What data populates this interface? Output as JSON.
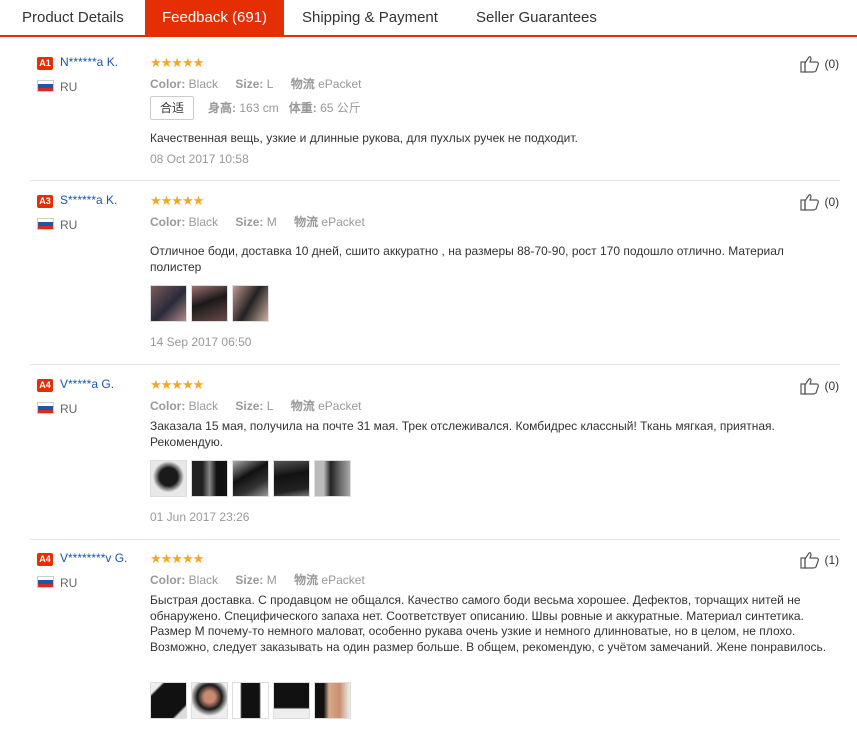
{
  "tabs": [
    {
      "label": "Product Details",
      "active": false
    },
    {
      "label": "Feedback (691)",
      "active": true
    },
    {
      "label": "Shipping & Payment",
      "active": false
    },
    {
      "label": "Seller Guarantees",
      "active": false
    }
  ],
  "attr_keys": {
    "color": "Color:",
    "size": "Size:",
    "ship": "物流",
    "fit": "合适",
    "height": "身高:",
    "weight": "体重:"
  },
  "country_flag_colors": [
    "#ffffff",
    "#1c57a7",
    "#d52b1e"
  ],
  "star_rating": 5,
  "reviews": [
    {
      "level": "A1",
      "name": "N******a K.",
      "country": "RU",
      "stars": "★★★★★",
      "color": "Black",
      "size": "L",
      "ship": "ePacket",
      "height": "163 cm",
      "weight": "65 公斤",
      "text": "Качественная вещь, узкие и длинные рукова, для пухлых ручек не подходит.",
      "date": "08 Oct 2017 10:58",
      "helpful": "(0)"
    },
    {
      "level": "A3",
      "name": "S******a K.",
      "country": "RU",
      "stars": "★★★★★",
      "color": "Black",
      "size": "M",
      "ship": "ePacket",
      "text": "Отличное боди, доставка 10 дней, сшито аккуратно , на размеры 88-70-90, рост 170 подошло отлично. Материал полистер",
      "photos": 3,
      "date": "14 Sep 2017 06:50",
      "helpful": "(0)"
    },
    {
      "level": "A4",
      "name": "V*****a G.",
      "country": "RU",
      "stars": "★★★★★",
      "color": "Black",
      "size": "L",
      "ship": "ePacket",
      "text": "Заказала 15 мая, получила на почте 31 мая. Трек отслеживался. Комбидрес классный! Ткань мягкая, приятная. Рекомендую.",
      "photos": 5,
      "date": "01 Jun 2017 23:26",
      "helpful": "(0)"
    },
    {
      "level": "A4",
      "name": "V********v G.",
      "country": "RU",
      "stars": "★★★★★",
      "color": "Black",
      "size": "M",
      "ship": "ePacket",
      "text": "Быстрая доставка. С продавцом не общался. Качество самого боди весьма хорошее. Дефектов, торчащих нитей не обнаружено. Специфического запаха нет. Соответствует описанию. Швы ровные и аккуратные. Материал синтетика. Размер М почему-то немного маловат, особенно рукава очень узкие и немного длинноватые, но в целом, не плохо. Возможно, следует заказывать на один размер больше. В общем, рекомендую, с учётом замечаний. Жене понравилось.",
      "photos": 5,
      "helpful": "(1)"
    }
  ]
}
